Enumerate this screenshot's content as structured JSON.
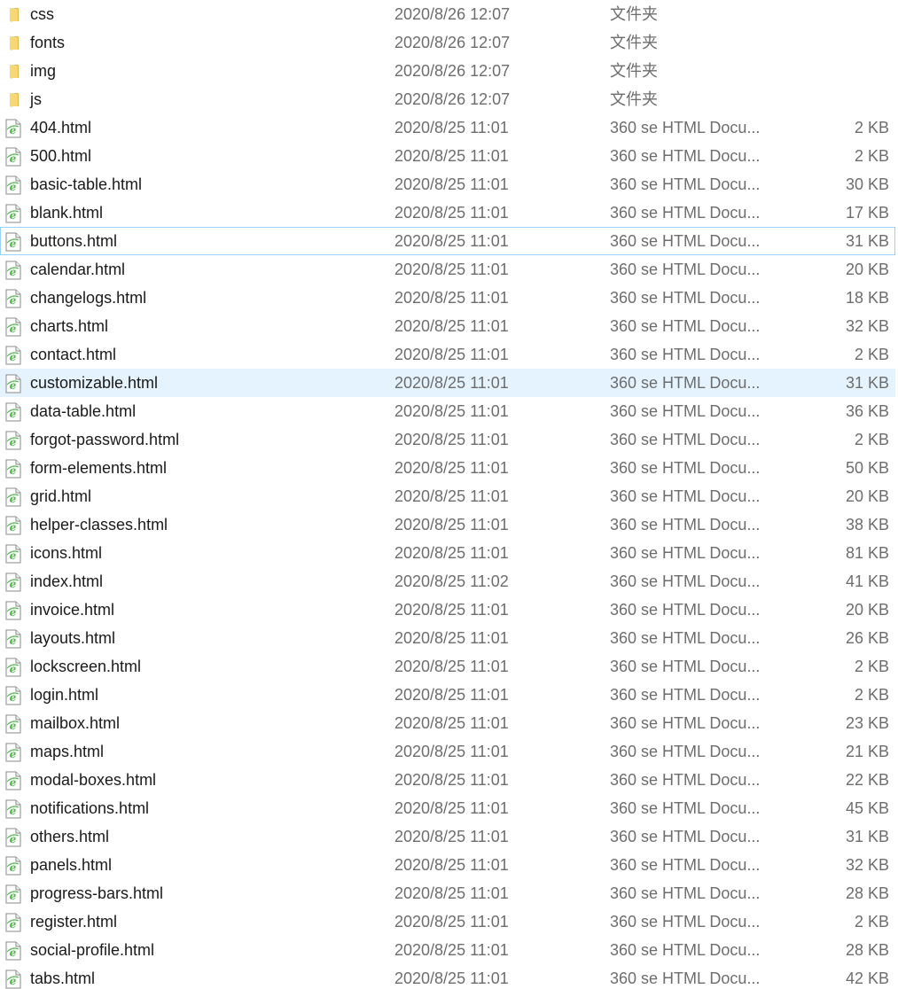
{
  "colors": {
    "folder": "#f8d775",
    "folder_dark": "#e0b94a",
    "ie_green": "#4cb84c",
    "selected_bg": "#e5f3ff",
    "hover_border": "#99d1ff"
  },
  "files": [
    {
      "name": "css",
      "modified": "2020/8/26 12:07",
      "type": "文件夹",
      "size": "",
      "icon": "folder-icon",
      "state": ""
    },
    {
      "name": "fonts",
      "modified": "2020/8/26 12:07",
      "type": "文件夹",
      "size": "",
      "icon": "folder-icon",
      "state": ""
    },
    {
      "name": "img",
      "modified": "2020/8/26 12:07",
      "type": "文件夹",
      "size": "",
      "icon": "folder-icon",
      "state": ""
    },
    {
      "name": "js",
      "modified": "2020/8/26 12:07",
      "type": "文件夹",
      "size": "",
      "icon": "folder-icon",
      "state": ""
    },
    {
      "name": "404.html",
      "modified": "2020/8/25 11:01",
      "type": "360 se HTML Docu...",
      "size": "2 KB",
      "icon": "html-document-icon",
      "state": ""
    },
    {
      "name": "500.html",
      "modified": "2020/8/25 11:01",
      "type": "360 se HTML Docu...",
      "size": "2 KB",
      "icon": "html-document-icon",
      "state": ""
    },
    {
      "name": "basic-table.html",
      "modified": "2020/8/25 11:01",
      "type": "360 se HTML Docu...",
      "size": "30 KB",
      "icon": "html-document-icon",
      "state": ""
    },
    {
      "name": "blank.html",
      "modified": "2020/8/25 11:01",
      "type": "360 se HTML Docu...",
      "size": "17 KB",
      "icon": "html-document-icon",
      "state": ""
    },
    {
      "name": "buttons.html",
      "modified": "2020/8/25 11:01",
      "type": "360 se HTML Docu...",
      "size": "31 KB",
      "icon": "html-document-icon",
      "state": "hovered"
    },
    {
      "name": "calendar.html",
      "modified": "2020/8/25 11:01",
      "type": "360 se HTML Docu...",
      "size": "20 KB",
      "icon": "html-document-icon",
      "state": ""
    },
    {
      "name": "changelogs.html",
      "modified": "2020/8/25 11:01",
      "type": "360 se HTML Docu...",
      "size": "18 KB",
      "icon": "html-document-icon",
      "state": ""
    },
    {
      "name": "charts.html",
      "modified": "2020/8/25 11:01",
      "type": "360 se HTML Docu...",
      "size": "32 KB",
      "icon": "html-document-icon",
      "state": ""
    },
    {
      "name": "contact.html",
      "modified": "2020/8/25 11:01",
      "type": "360 se HTML Docu...",
      "size": "2 KB",
      "icon": "html-document-icon",
      "state": ""
    },
    {
      "name": "customizable.html",
      "modified": "2020/8/25 11:01",
      "type": "360 se HTML Docu...",
      "size": "31 KB",
      "icon": "html-document-icon",
      "state": "selected"
    },
    {
      "name": "data-table.html",
      "modified": "2020/8/25 11:01",
      "type": "360 se HTML Docu...",
      "size": "36 KB",
      "icon": "html-document-icon",
      "state": ""
    },
    {
      "name": "forgot-password.html",
      "modified": "2020/8/25 11:01",
      "type": "360 se HTML Docu...",
      "size": "2 KB",
      "icon": "html-document-icon",
      "state": ""
    },
    {
      "name": "form-elements.html",
      "modified": "2020/8/25 11:01",
      "type": "360 se HTML Docu...",
      "size": "50 KB",
      "icon": "html-document-icon",
      "state": ""
    },
    {
      "name": "grid.html",
      "modified": "2020/8/25 11:01",
      "type": "360 se HTML Docu...",
      "size": "20 KB",
      "icon": "html-document-icon",
      "state": ""
    },
    {
      "name": "helper-classes.html",
      "modified": "2020/8/25 11:01",
      "type": "360 se HTML Docu...",
      "size": "38 KB",
      "icon": "html-document-icon",
      "state": ""
    },
    {
      "name": "icons.html",
      "modified": "2020/8/25 11:01",
      "type": "360 se HTML Docu...",
      "size": "81 KB",
      "icon": "html-document-icon",
      "state": ""
    },
    {
      "name": "index.html",
      "modified": "2020/8/25 11:02",
      "type": "360 se HTML Docu...",
      "size": "41 KB",
      "icon": "html-document-icon",
      "state": ""
    },
    {
      "name": "invoice.html",
      "modified": "2020/8/25 11:01",
      "type": "360 se HTML Docu...",
      "size": "20 KB",
      "icon": "html-document-icon",
      "state": ""
    },
    {
      "name": "layouts.html",
      "modified": "2020/8/25 11:01",
      "type": "360 se HTML Docu...",
      "size": "26 KB",
      "icon": "html-document-icon",
      "state": ""
    },
    {
      "name": "lockscreen.html",
      "modified": "2020/8/25 11:01",
      "type": "360 se HTML Docu...",
      "size": "2 KB",
      "icon": "html-document-icon",
      "state": ""
    },
    {
      "name": "login.html",
      "modified": "2020/8/25 11:01",
      "type": "360 se HTML Docu...",
      "size": "2 KB",
      "icon": "html-document-icon",
      "state": ""
    },
    {
      "name": "mailbox.html",
      "modified": "2020/8/25 11:01",
      "type": "360 se HTML Docu...",
      "size": "23 KB",
      "icon": "html-document-icon",
      "state": ""
    },
    {
      "name": "maps.html",
      "modified": "2020/8/25 11:01",
      "type": "360 se HTML Docu...",
      "size": "21 KB",
      "icon": "html-document-icon",
      "state": ""
    },
    {
      "name": "modal-boxes.html",
      "modified": "2020/8/25 11:01",
      "type": "360 se HTML Docu...",
      "size": "22 KB",
      "icon": "html-document-icon",
      "state": ""
    },
    {
      "name": "notifications.html",
      "modified": "2020/8/25 11:01",
      "type": "360 se HTML Docu...",
      "size": "45 KB",
      "icon": "html-document-icon",
      "state": ""
    },
    {
      "name": "others.html",
      "modified": "2020/8/25 11:01",
      "type": "360 se HTML Docu...",
      "size": "31 KB",
      "icon": "html-document-icon",
      "state": ""
    },
    {
      "name": "panels.html",
      "modified": "2020/8/25 11:01",
      "type": "360 se HTML Docu...",
      "size": "32 KB",
      "icon": "html-document-icon",
      "state": ""
    },
    {
      "name": "progress-bars.html",
      "modified": "2020/8/25 11:01",
      "type": "360 se HTML Docu...",
      "size": "28 KB",
      "icon": "html-document-icon",
      "state": ""
    },
    {
      "name": "register.html",
      "modified": "2020/8/25 11:01",
      "type": "360 se HTML Docu...",
      "size": "2 KB",
      "icon": "html-document-icon",
      "state": ""
    },
    {
      "name": "social-profile.html",
      "modified": "2020/8/25 11:01",
      "type": "360 se HTML Docu...",
      "size": "28 KB",
      "icon": "html-document-icon",
      "state": ""
    },
    {
      "name": "tabs.html",
      "modified": "2020/8/25 11:01",
      "type": "360 se HTML Docu...",
      "size": "42 KB",
      "icon": "html-document-icon",
      "state": ""
    }
  ]
}
